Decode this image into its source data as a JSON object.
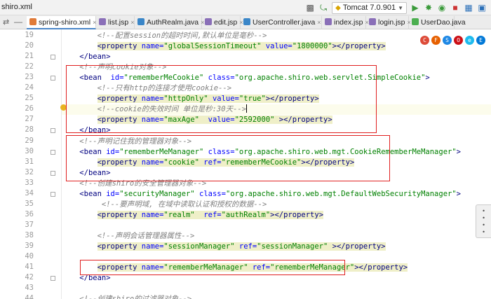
{
  "window": {
    "project_title": "shiro.xml",
    "run_config": "Tomcat 7.0.901"
  },
  "toolbar": {
    "icons": [
      "hammer-icon",
      "run-icon",
      "debug-icon",
      "coverage-icon",
      "stop-icon",
      "structure-icon",
      "sdk-icon"
    ]
  },
  "tabs": [
    {
      "label": "spring-shiro.xml",
      "icon": "xml-file-icon",
      "color": "#e07b39",
      "closable": true,
      "active": true
    },
    {
      "label": "list.jsp",
      "icon": "jsp-file-icon",
      "color": "#8a6fb8",
      "closable": true,
      "active": false
    },
    {
      "label": "AuthRealm.java",
      "icon": "java-class-icon",
      "color": "#3a86c8",
      "closable": true,
      "active": false
    },
    {
      "label": "edit.jsp",
      "icon": "jsp-file-icon",
      "color": "#8a6fb8",
      "closable": true,
      "active": false
    },
    {
      "label": "UserController.java",
      "icon": "java-class-icon",
      "color": "#3a86c8",
      "closable": true,
      "active": false
    },
    {
      "label": "index.jsp",
      "icon": "jsp-file-icon",
      "color": "#8a6fb8",
      "closable": true,
      "active": false
    },
    {
      "label": "login.jsp",
      "icon": "jsp-file-icon",
      "color": "#8a6fb8",
      "closable": true,
      "active": false
    },
    {
      "label": "UserDao.java",
      "icon": "java-interface-icon",
      "color": "#4caf50",
      "closable": false,
      "active": false
    }
  ],
  "close_glyph": "×",
  "editor": {
    "lines": [
      {
        "n": "19",
        "parts": [
          {
            "t": "        "
          },
          {
            "c": "cm",
            "t": "<!--配置session的超时时间,默认单位是毫秒-->"
          }
        ]
      },
      {
        "n": "20",
        "hl": true,
        "parts": [
          {
            "t": "        "
          },
          {
            "c": "tg",
            "t": "<property "
          },
          {
            "c": "an",
            "t": "name="
          },
          {
            "c": "av",
            "t": "\"globalSessionTimeout\""
          },
          {
            "c": "an",
            "t": " value="
          },
          {
            "c": "av",
            "t": "\"1800000\""
          },
          {
            "c": "tg",
            "t": "></property>"
          }
        ]
      },
      {
        "n": "21",
        "parts": [
          {
            "t": "    "
          },
          {
            "c": "tg",
            "t": "</bean>"
          }
        ]
      },
      {
        "n": "22",
        "parts": [
          {
            "t": "    "
          },
          {
            "c": "cm",
            "t": "<!--声明cookie对象-->"
          }
        ]
      },
      {
        "n": "23",
        "parts": [
          {
            "t": "    "
          },
          {
            "c": "tg",
            "t": "<bean  "
          },
          {
            "c": "an",
            "t": "id="
          },
          {
            "c": "av",
            "t": "\"rememberMeCookie\""
          },
          {
            "c": "an",
            "t": " class="
          },
          {
            "c": "av",
            "t": "\"org.apache.shiro.web.servlet.SimpleCookie\""
          },
          {
            "c": "tg",
            "t": ">"
          }
        ]
      },
      {
        "n": "24",
        "parts": [
          {
            "t": "        "
          },
          {
            "c": "cm",
            "t": "<!--只有http的连接才使用cookie-->"
          }
        ]
      },
      {
        "n": "25",
        "hl": true,
        "parts": [
          {
            "t": "        "
          },
          {
            "c": "tg",
            "t": "<property "
          },
          {
            "c": "an",
            "t": "name="
          },
          {
            "c": "av",
            "t": "\"httpOnly\""
          },
          {
            "c": "an",
            "t": " value="
          },
          {
            "c": "av",
            "t": "\"true\""
          },
          {
            "c": "tg",
            "t": "></property>"
          }
        ]
      },
      {
        "n": "26",
        "cur": true,
        "parts": [
          {
            "t": "        "
          },
          {
            "c": "cm",
            "t": "<!--cookie的失效时间 单位是秒:30天-->"
          }
        ]
      },
      {
        "n": "27",
        "hl": true,
        "parts": [
          {
            "t": "        "
          },
          {
            "c": "tg",
            "t": "<property "
          },
          {
            "c": "an",
            "t": "name="
          },
          {
            "c": "av",
            "t": "\"maxAge\""
          },
          {
            "c": "an",
            "t": "  value="
          },
          {
            "c": "av",
            "t": "\"2592000\""
          },
          {
            "c": "tg",
            "t": " ></property>"
          }
        ]
      },
      {
        "n": "28",
        "parts": [
          {
            "t": "    "
          },
          {
            "c": "tg",
            "t": "</bean>"
          }
        ]
      },
      {
        "n": "29",
        "parts": [
          {
            "t": "    "
          },
          {
            "c": "cm",
            "t": "<!--声明记住我的管理器对象-->"
          }
        ]
      },
      {
        "n": "30",
        "parts": [
          {
            "t": "    "
          },
          {
            "c": "tg",
            "t": "<bean "
          },
          {
            "c": "an",
            "t": "id="
          },
          {
            "c": "av",
            "t": "\"rememberMeManager\""
          },
          {
            "c": "an",
            "t": " class="
          },
          {
            "c": "av",
            "t": "\"org.apache.shiro.web.mgt.CookieRememberMeManager\""
          },
          {
            "c": "tg",
            "t": ">"
          }
        ]
      },
      {
        "n": "31",
        "hl": true,
        "parts": [
          {
            "t": "        "
          },
          {
            "c": "tg",
            "t": "<property "
          },
          {
            "c": "an",
            "t": "name="
          },
          {
            "c": "av",
            "t": "\"cookie\""
          },
          {
            "c": "an",
            "t": " ref="
          },
          {
            "c": "av",
            "t": "\"rememberMeCookie\""
          },
          {
            "c": "tg",
            "t": "></property>"
          }
        ]
      },
      {
        "n": "32",
        "parts": [
          {
            "t": "    "
          },
          {
            "c": "tg",
            "t": "</bean>"
          }
        ]
      },
      {
        "n": "33",
        "parts": [
          {
            "t": "    "
          },
          {
            "c": "cm",
            "t": "<!--创建shiro的安全管理器对象-->"
          }
        ]
      },
      {
        "n": "34",
        "parts": [
          {
            "t": "    "
          },
          {
            "c": "tg",
            "t": "<bean "
          },
          {
            "c": "an",
            "t": "id="
          },
          {
            "c": "av",
            "t": "\"securityManager\""
          },
          {
            "c": "an",
            "t": " class="
          },
          {
            "c": "av",
            "t": "\"org.apache.shiro.web.mgt.DefaultWebSecurityManager\""
          },
          {
            "c": "tg",
            "t": ">"
          }
        ]
      },
      {
        "n": "35",
        "parts": [
          {
            "t": "         "
          },
          {
            "c": "cm",
            "t": "<!--要声明域, 在域中读取认证和授权的数据-->"
          }
        ]
      },
      {
        "n": "36",
        "hl": true,
        "parts": [
          {
            "t": "        "
          },
          {
            "c": "tg",
            "t": "<property "
          },
          {
            "c": "an",
            "t": "name="
          },
          {
            "c": "av",
            "t": "\"realm\""
          },
          {
            "c": "an",
            "t": "  ref="
          },
          {
            "c": "av",
            "t": "\"authRealm\""
          },
          {
            "c": "tg",
            "t": "></property>"
          }
        ]
      },
      {
        "n": "37",
        "parts": []
      },
      {
        "n": "38",
        "parts": [
          {
            "t": "        "
          },
          {
            "c": "cm",
            "t": "<!--声明会话管理器属性-->"
          }
        ]
      },
      {
        "n": "39",
        "hl": true,
        "parts": [
          {
            "t": "        "
          },
          {
            "c": "tg",
            "t": "<property "
          },
          {
            "c": "an",
            "t": "name="
          },
          {
            "c": "av",
            "t": "\"sessionManager\""
          },
          {
            "c": "an",
            "t": " ref="
          },
          {
            "c": "av",
            "t": "\"sessionManager\""
          },
          {
            "c": "tg",
            "t": " ></property>"
          }
        ]
      },
      {
        "n": "40",
        "parts": []
      },
      {
        "n": "41",
        "hl": true,
        "parts": [
          {
            "t": "        "
          },
          {
            "c": "tg",
            "t": "<property "
          },
          {
            "c": "an",
            "t": "name="
          },
          {
            "c": "av",
            "t": "\"rememberMeManager\""
          },
          {
            "c": "an",
            "t": " ref="
          },
          {
            "c": "av",
            "t": "\"rememberMeManager\""
          },
          {
            "c": "tg",
            "t": "></property>"
          }
        ]
      },
      {
        "n": "42",
        "parts": [
          {
            "t": "    "
          },
          {
            "c": "tg",
            "t": "</bean>"
          }
        ]
      },
      {
        "n": "43",
        "parts": []
      },
      {
        "n": "44",
        "parts": [
          {
            "t": "    "
          },
          {
            "c": "cm",
            "t": "<!--创建shiro的过滤器对象-->"
          }
        ]
      }
    ]
  },
  "browser_icons": [
    {
      "name": "chrome-icon",
      "color": "#dd4b39",
      "glyph": "C"
    },
    {
      "name": "firefox-icon",
      "color": "#e66000",
      "glyph": "F"
    },
    {
      "name": "safari-icon",
      "color": "#1e88e5",
      "glyph": "S"
    },
    {
      "name": "opera-icon",
      "color": "#cc0f16",
      "glyph": "O"
    },
    {
      "name": "ie-icon",
      "color": "#1ebbee",
      "glyph": "e"
    },
    {
      "name": "edge-icon",
      "color": "#0078d7",
      "glyph": "E"
    }
  ],
  "side_widget_text": "•\n•\n•\n•"
}
